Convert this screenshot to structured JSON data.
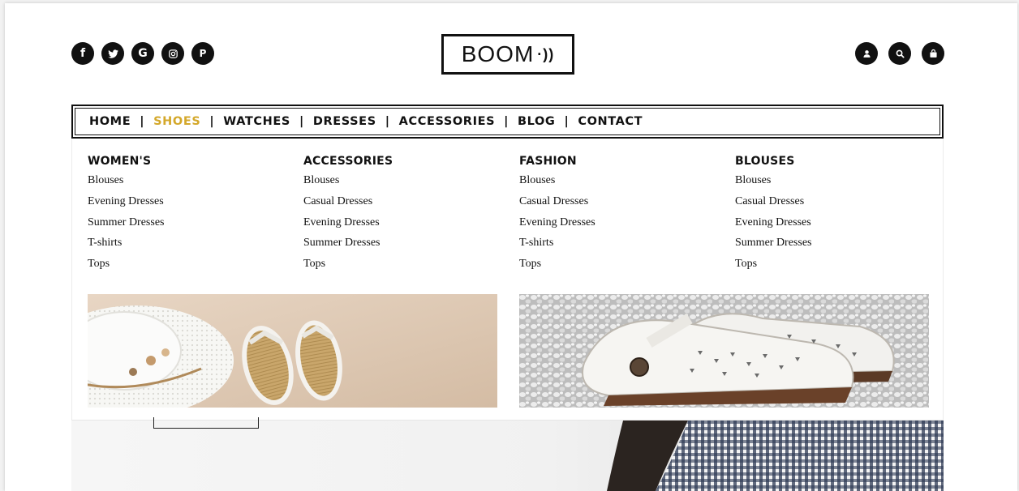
{
  "brand": {
    "logo_text": "BOOM",
    "logo_mark": "·))"
  },
  "social": [
    {
      "icon": "facebook-icon",
      "glyph": "f"
    },
    {
      "icon": "twitter-icon",
      "glyph": ""
    },
    {
      "icon": "google-icon",
      "glyph": "G"
    },
    {
      "icon": "instagram-icon",
      "glyph": ""
    },
    {
      "icon": "pinterest-icon",
      "glyph": "P"
    }
  ],
  "header_icons": [
    "user-icon",
    "search-icon",
    "cart-icon"
  ],
  "nav": {
    "items": [
      "HOME",
      "SHOES",
      "WATCHES",
      "DRESSES",
      "ACCESSORIES",
      "BLOG",
      "CONTACT"
    ],
    "active": "SHOES",
    "active_color": "#d4a82b"
  },
  "mega_menu": {
    "columns": [
      {
        "title": "WOMEN'S",
        "links": [
          "Blouses",
          "Evening Dresses",
          "Summer Dresses",
          "T-shirts",
          "Tops"
        ]
      },
      {
        "title": "ACCESSORIES",
        "links": [
          "Blouses",
          "Casual Dresses",
          "Evening Dresses",
          "Summer Dresses",
          "Tops"
        ]
      },
      {
        "title": "FASHION",
        "links": [
          "Blouses",
          "Casual Dresses",
          "Evening Dresses",
          "T-shirts",
          "Tops"
        ]
      },
      {
        "title": "BLOUSES",
        "links": [
          "Blouses",
          "Casual Dresses",
          "Evening Dresses",
          "Summer Dresses",
          "Tops"
        ]
      }
    ],
    "banners": [
      "beach-hat-flip-flops-image",
      "white-leather-shoes-image"
    ]
  }
}
